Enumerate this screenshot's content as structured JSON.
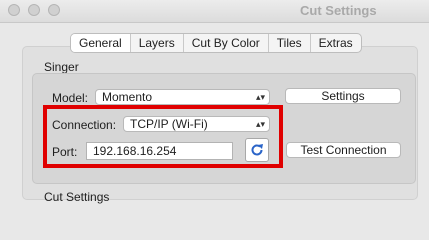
{
  "window": {
    "title": "Cut Settings"
  },
  "tabs": [
    {
      "label": "General",
      "selected": true
    },
    {
      "label": "Layers",
      "selected": false
    },
    {
      "label": "Cut By Color",
      "selected": false
    },
    {
      "label": "Tiles",
      "selected": false
    },
    {
      "label": "Extras",
      "selected": false
    }
  ],
  "group": {
    "title": "Singer"
  },
  "model": {
    "label": "Model:",
    "value": "Momento"
  },
  "settings_button": {
    "label": "Settings"
  },
  "connection": {
    "label": "Connection:",
    "value": "TCP/IP (Wi-Fi)"
  },
  "port": {
    "label": "Port:",
    "value": "192.168.16.254"
  },
  "refresh_icon": "refresh-icon",
  "test_button": {
    "label": "Test Connection"
  },
  "cut_settings_label": "Cut Settings",
  "colors": {
    "highlight": "#e00000",
    "refresh_icon": "#2a64c8"
  }
}
